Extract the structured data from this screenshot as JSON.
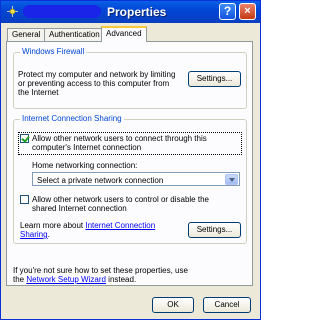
{
  "window": {
    "title": "Properties",
    "help_label": "?",
    "close_label": "×"
  },
  "tabs": [
    {
      "label": "General"
    },
    {
      "label": "Authentication"
    },
    {
      "label": "Advanced"
    }
  ],
  "firewall": {
    "heading": "Windows Firewall",
    "description_line1": "Protect my computer and network by limiting",
    "description_line2": "or preventing access to this computer from",
    "description_line3": "the Internet",
    "settings_label": "Settings..."
  },
  "ics": {
    "heading": "Internet Connection Sharing",
    "allow_connect_line1": "Allow other network users to connect through this",
    "allow_connect_line2": "computer's Internet connection",
    "allow_connect_checked": true,
    "home_network_label": "Home networking connection:",
    "home_network_value": "Select a private network connection",
    "allow_control_line1": "Allow other network users to control or disable the",
    "allow_control_line2": "shared Internet connection",
    "allow_control_checked": false,
    "learn_more_prefix": "Learn more about ",
    "learn_more_link_part1": "Internet Connection",
    "learn_more_link_part2": "Sharing",
    "learn_more_suffix": ".",
    "settings_label": "Settings..."
  },
  "footer": {
    "note_line1": "If you're not sure how to set these properties, use",
    "note_prefix": "the ",
    "wizard_link": "Network Setup Wizard",
    "note_suffix": " instead."
  },
  "buttons": {
    "ok_label": "OK",
    "cancel_label": "Cancel"
  }
}
